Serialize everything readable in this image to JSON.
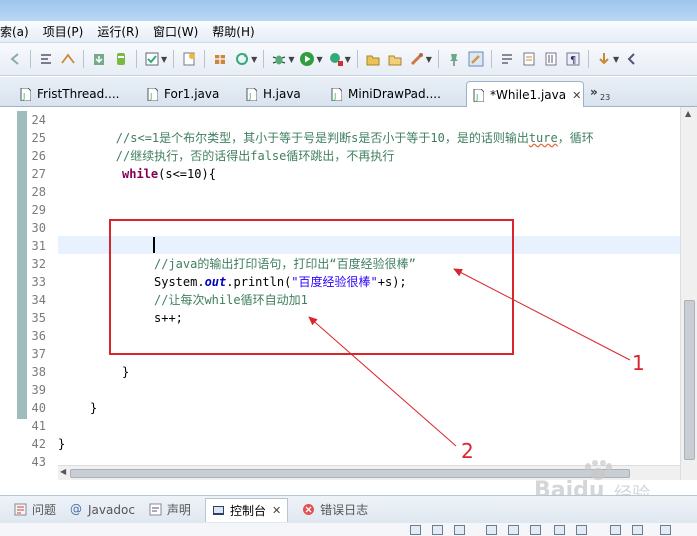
{
  "menu": [
    "索(a)",
    "项目(P)",
    "运行(R)",
    "窗口(W)",
    "帮助(H)"
  ],
  "tabs": [
    {
      "label": "FristThread....",
      "active": false
    },
    {
      "label": "For1.java",
      "active": false
    },
    {
      "label": "H.java",
      "active": false
    },
    {
      "label": "MiniDrawPad....",
      "active": false
    },
    {
      "label": "*While1.java",
      "active": true,
      "close": "✕"
    }
  ],
  "tabs_overflow": {
    "chevron": "»",
    "count": "23"
  },
  "editor": {
    "line_numbers": [
      "24",
      "25",
      "26",
      "27",
      "28",
      "29",
      "30",
      "31",
      "32",
      "33",
      "34",
      "35",
      "36",
      "37",
      "38",
      "39",
      "40",
      "41",
      "42",
      "43"
    ],
    "lines": {
      "l25": "        //s<=1是个布尔类型，其小于等于号是判断s是否小于等于10，是的话则输出",
      "l25_squiggle": "ture",
      "l25_tail": "，循环",
      "l26": "        //继续执行，否的话得出false循环跳出，不再执行",
      "l27_kw": "while",
      "l27_rest": "(s<=10){",
      "l32": "//java的输出打印语句，打印出“百度经验很棒”",
      "l33_a": "System.",
      "l33_field": "out",
      "l33_b": ".println(",
      "l33_str": "\"百度经验很棒\"",
      "l33_c": "+s);",
      "l34": "//让每次while循环自动加1",
      "l35": "s++;",
      "l38": "}",
      "l40": "}",
      "l42": "}"
    }
  },
  "annotations": {
    "label1": "1",
    "label2": "2",
    "color": "#d9262c"
  },
  "bottom_tabs": [
    {
      "label": "问题",
      "icon": "problems-icon"
    },
    {
      "label": "Javadoc",
      "icon": "javadoc-icon"
    },
    {
      "label": "声明",
      "icon": "declaration-icon"
    },
    {
      "label": "控制台",
      "icon": "console-icon",
      "active": true,
      "close": "✕"
    },
    {
      "label": "错误日志",
      "icon": "error-log-icon"
    }
  ],
  "watermark": {
    "text": "Baidu",
    "sub": "经验"
  },
  "colors": {
    "comment": "#3f7f5f",
    "keyword": "#7f0055",
    "string": "#2a00ff",
    "field": "#0000c0"
  }
}
